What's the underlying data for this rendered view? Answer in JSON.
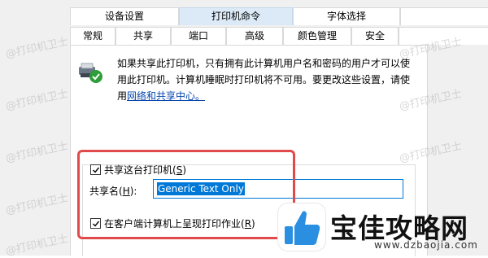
{
  "tabs_row1": [
    "设备设置",
    "打印机命令",
    "字体选择"
  ],
  "tabs_row2": [
    "常规",
    "共享",
    "端口",
    "高级",
    "颜色管理",
    "安全"
  ],
  "active_tab_row1": "打印机命令",
  "active_tab_row2": "共享",
  "info": {
    "line1": "如果共享此打印机，只有拥有此计算机用户名和密码的用户才可以使",
    "line2": "用此打印机。计算机睡眠时打印机将不可用。要更改这些设置，请使",
    "line3_prefix": "用",
    "link": "网络和共享中心。"
  },
  "share_checkbox": {
    "label_main": "共享这台打印机(",
    "accel": "S",
    "label_end": ")",
    "checked": true
  },
  "share_name": {
    "label_main": "共享名(",
    "accel": "H",
    "label_end": "):",
    "value": "Generic  Text Only"
  },
  "render_checkbox": {
    "label_main": "在客户端计算机上呈现打印作业(",
    "accel": "R",
    "label_end": ")",
    "checked": true
  },
  "watermarks": [
    "@打印机卫士",
    "@打印机卫士",
    "@打印机卫士",
    "@打印机卫士",
    "@打印机卫士",
    "@打印机卫士",
    "@打印机卫士",
    "@打印机卫士"
  ],
  "logo": {
    "title": "宝佳攻略网",
    "url": "www.dzbaojia.com"
  },
  "colors": {
    "accent": "#0078d7",
    "highlight_border": "#e04a4a",
    "link": "#0645ad"
  },
  "icons": [
    "shared-printer-icon",
    "checkmark-icon",
    "thumbs-up-logo-icon"
  ]
}
